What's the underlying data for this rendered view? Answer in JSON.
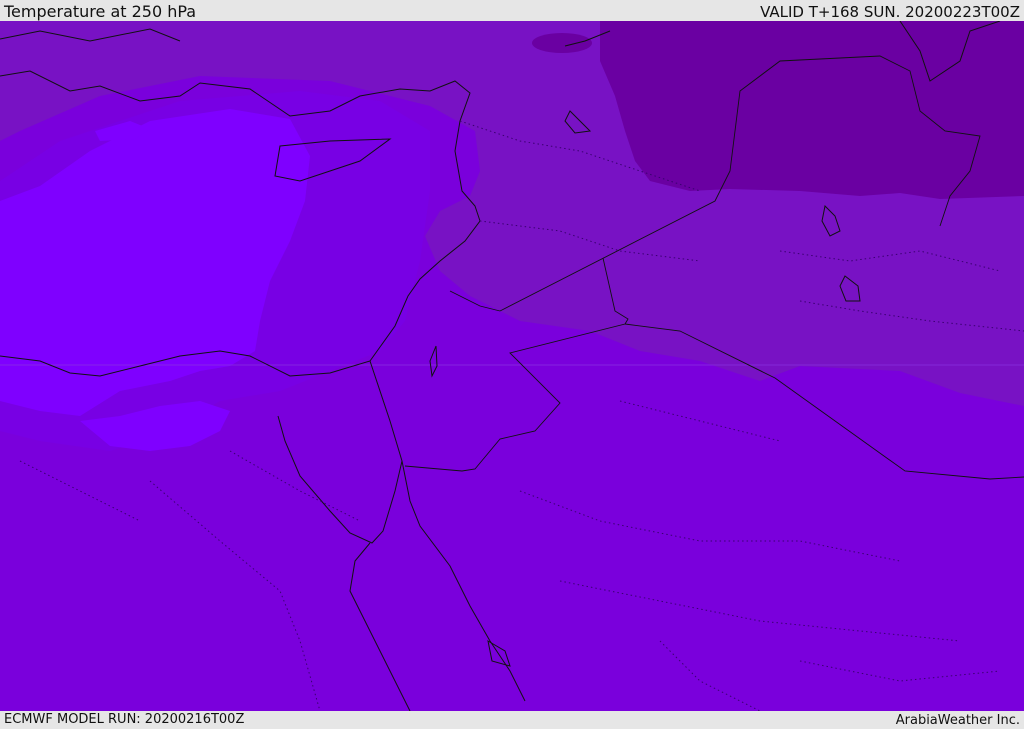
{
  "header": {
    "title": "Temperature at 250 hPa",
    "valid": "VALID T+168 SUN. 20200223T00Z"
  },
  "footer": {
    "model_run": "ECMWF MODEL RUN: 20200216T00Z",
    "credit": "ArabiaWeather Inc."
  },
  "map": {
    "colors": {
      "background": "#7a00dc",
      "mediterranean_cold": "#7f00ff",
      "transition": "#7800e4",
      "north_band": "#7812c4",
      "northeast_dark": "#6a00a2",
      "coastline": "#111111",
      "border_dotted": "#3a0070"
    }
  }
}
